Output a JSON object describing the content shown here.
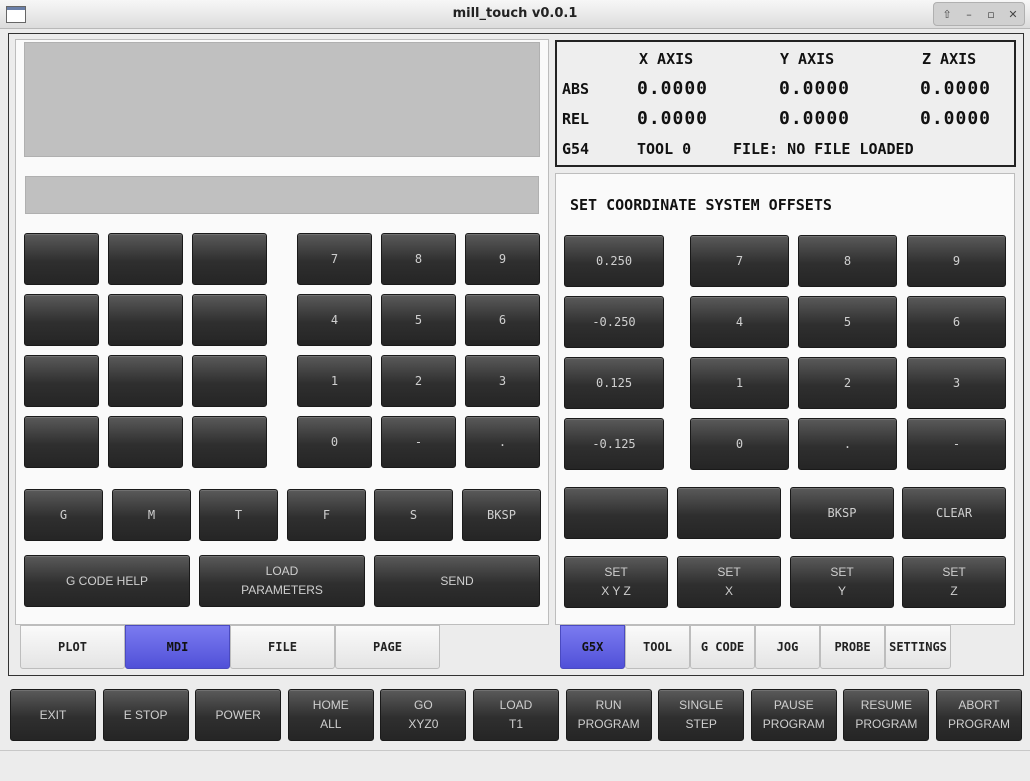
{
  "window": {
    "title": "mill_touch v0.0.1"
  },
  "mdi": {
    "blank_keys": [
      "",
      "",
      "",
      "",
      "",
      "",
      "",
      "",
      "",
      "",
      "",
      ""
    ],
    "numpad": [
      "7",
      "8",
      "9",
      "4",
      "5",
      "6",
      "1",
      "2",
      "3",
      "0",
      "-",
      "."
    ],
    "letter_row": [
      "G",
      "M",
      "T",
      "F",
      "S",
      "BKSP"
    ],
    "action_row": [
      "G CODE HELP",
      "LOAD\nPARAMETERS",
      "SEND"
    ]
  },
  "dro": {
    "headers": [
      "X AXIS",
      "Y AXIS",
      "Z AXIS"
    ],
    "rows": [
      {
        "label": "ABS",
        "values": [
          "0.0000",
          "0.0000",
          "0.0000"
        ]
      },
      {
        "label": "REL",
        "values": [
          "0.0000",
          "0.0000",
          "0.0000"
        ]
      }
    ],
    "status": {
      "coord": "G54",
      "tool": "TOOL 0",
      "file": "FILE: NO FILE LOADED"
    }
  },
  "offsets": {
    "title": "SET COORDINATE SYSTEM OFFSETS",
    "increments": [
      "0.250",
      "-0.250",
      "0.125",
      "-0.125"
    ],
    "numpad": [
      "7",
      "8",
      "9",
      "4",
      "5",
      "6",
      "1",
      "2",
      "3",
      "0",
      ".",
      "-"
    ],
    "edit_row": [
      "",
      "",
      "BKSP",
      "CLEAR"
    ],
    "set_row": [
      "SET\nX Y Z",
      "SET\nX",
      "SET\nY",
      "SET\nZ"
    ]
  },
  "left_tabs": [
    {
      "label": "PLOT",
      "active": false
    },
    {
      "label": "MDI",
      "active": true
    },
    {
      "label": "FILE",
      "active": false
    },
    {
      "label": "PAGE",
      "active": false
    }
  ],
  "right_tabs": [
    {
      "label": "G5X",
      "active": true
    },
    {
      "label": "TOOL",
      "active": false
    },
    {
      "label": "G CODE",
      "active": false
    },
    {
      "label": "JOG",
      "active": false
    },
    {
      "label": "PROBE",
      "active": false
    },
    {
      "label": "SETTINGS",
      "active": false
    }
  ],
  "bottom_bar": [
    "EXIT",
    "E STOP",
    "POWER",
    "HOME\nALL",
    "GO\nXYZ0",
    "LOAD\nT1",
    "RUN\nPROGRAM",
    "SINGLE\nSTEP",
    "PAUSE\nPROGRAM",
    "RESUME\nPROGRAM",
    "ABORT\nPROGRAM"
  ],
  "colors": {
    "active_tab": "#5f5fe6",
    "button": "#333333",
    "display": "#c0c0c0"
  }
}
